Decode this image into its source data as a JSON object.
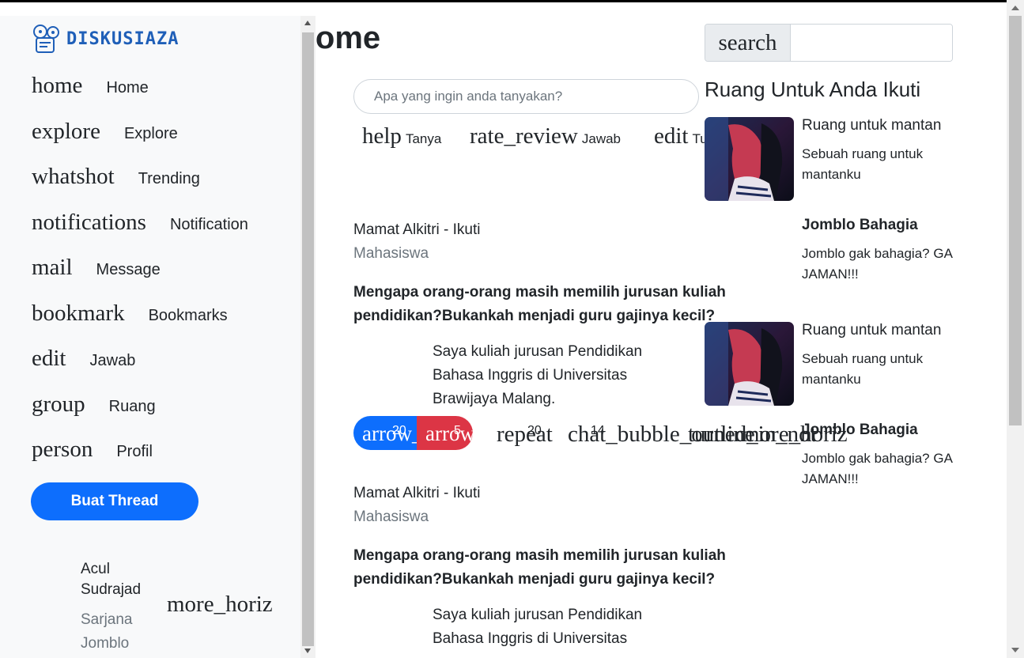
{
  "app": {
    "brand": "DISKUSIAZA",
    "page_title": "Home"
  },
  "sidebar": {
    "nav": [
      {
        "icon": "home",
        "label": "Home"
      },
      {
        "icon": "explore",
        "label": "Explore"
      },
      {
        "icon": "whatshot",
        "label": "Trending"
      },
      {
        "icon": "notifications",
        "label": "Notification"
      },
      {
        "icon": "mail",
        "label": "Message"
      },
      {
        "icon": "bookmark",
        "label": "Bookmarks"
      },
      {
        "icon": "edit",
        "label": "Jawab"
      },
      {
        "icon": "group",
        "label": "Ruang"
      },
      {
        "icon": "person",
        "label": "Profil"
      }
    ],
    "create_button": "Buat Thread",
    "user": {
      "name": "Acul Sudrajad",
      "subtitle": "Sarjana Jomblo",
      "more_icon": "more_horiz"
    }
  },
  "composer": {
    "placeholder": "Apa yang ingin anda tanyakan?",
    "actions": [
      {
        "icon": "help",
        "label": "Tanya"
      },
      {
        "icon": "rate_review",
        "label": "Jawab"
      },
      {
        "icon": "edit",
        "label": "Tulis"
      }
    ]
  },
  "feed": [
    {
      "author": "Mamat Alkitri - Ikuti",
      "role": "Mahasiswa",
      "question": "Mengapa orang-orang masih memilih jurusan kuliah pendidikan?Bukankah menjadi guru gajinya kecil?",
      "answer": "Saya kuliah jurusan Pendidikan Bahasa Inggris di Universitas Brawijaya Malang.",
      "upvote_icon": "arrow_upward",
      "upvotes": "20",
      "downvote_icon": "arrow_downward",
      "downvotes": "5",
      "repeat_icon": "repeat",
      "reposts": "20",
      "comment_icon": "chat_bubble_outline",
      "comments": "14",
      "share_icon": "turned_in_not",
      "more_icon": "more_horiz"
    },
    {
      "author": "Mamat Alkitri - Ikuti",
      "role": "Mahasiswa",
      "question": "Mengapa orang-orang masih memilih jurusan kuliah pendidikan?Bukankah menjadi guru gajinya kecil?",
      "answer": "Saya kuliah jurusan Pendidikan Bahasa Inggris di Universitas"
    }
  ],
  "right_panel": {
    "search_label": "search",
    "title": "Ruang Untuk Anda Ikuti",
    "rooms": [
      {
        "name": "Ruang untuk mantan",
        "desc": "Sebuah ruang untuk mantanku"
      },
      {
        "name": "Jomblo Bahagia",
        "desc": "Jomblo gak bahagia? GA JAMAN!!!"
      },
      {
        "name": "Ruang untuk mantan",
        "desc": "Sebuah ruang untuk mantanku"
      },
      {
        "name": "Jomblo Bahagia",
        "desc": "Jomblo gak bahagia? GA JAMAN!!!"
      }
    ]
  },
  "colors": {
    "primary": "#0d6efd",
    "danger": "#dc3545",
    "sidebar_bg": "#f8f9fa",
    "muted": "#6c757d"
  }
}
